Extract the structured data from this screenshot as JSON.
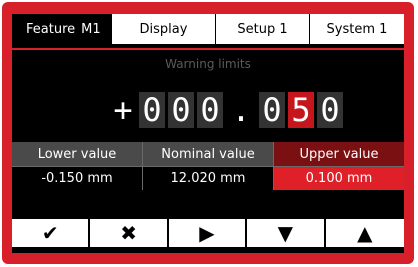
{
  "tabs": {
    "feature_label": "Feature",
    "feature_id": "M1",
    "display": "Display",
    "setup": "Setup 1",
    "system": "System 1"
  },
  "subtitle": "Warning limits",
  "digit_display": {
    "sign": "+",
    "d1": "0",
    "d2": "0",
    "d3": "0",
    "dot": ".",
    "d4": "0",
    "d5": "5",
    "d6": "0",
    "selected_digit": "d5"
  },
  "table": {
    "headers": {
      "lower": "Lower value",
      "nominal": "Nominal value",
      "upper": "Upper value"
    },
    "values": {
      "lower": "-0.150 mm",
      "nominal": "12.020 mm",
      "upper": "0.100 mm"
    },
    "selected_column": "upper"
  },
  "buttons": {
    "confirm": "✔",
    "cancel": "✖",
    "next": "▶",
    "down": "▼",
    "up": "▲"
  },
  "colors": {
    "accent": "#d8202a",
    "selected_cell": "#e02028",
    "selected_header": "#7a1012",
    "screen_bg": "#000000"
  }
}
